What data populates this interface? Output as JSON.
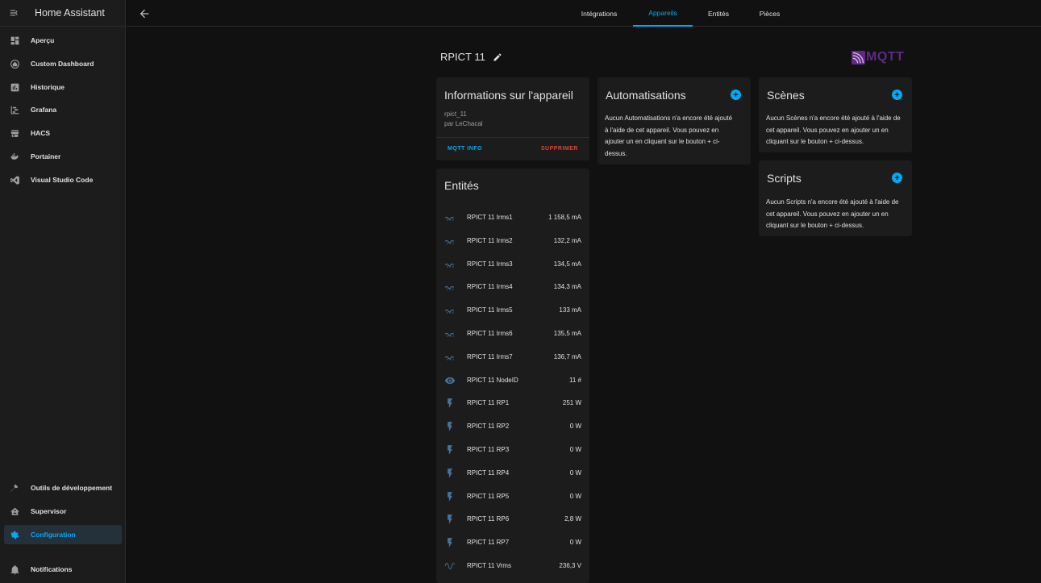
{
  "app": {
    "title": "Home Assistant"
  },
  "sidebar": {
    "items": [
      {
        "label": "Aperçu",
        "icon": "dashboard-icon"
      },
      {
        "label": "Custom Dashboard",
        "icon": "home-assistant-icon"
      },
      {
        "label": "Historique",
        "icon": "chart-icon"
      },
      {
        "label": "Grafana",
        "icon": "chart-timeline-icon"
      },
      {
        "label": "HACS",
        "icon": "store-icon"
      },
      {
        "label": "Portainer",
        "icon": "docker-icon"
      },
      {
        "label": "Visual Studio Code",
        "icon": "vscode-icon"
      }
    ],
    "bottom_items": [
      {
        "label": "Outils de développement",
        "icon": "hammer-icon"
      },
      {
        "label": "Supervisor",
        "icon": "supervisor-icon"
      },
      {
        "label": "Configuration",
        "icon": "gear-icon"
      }
    ],
    "notifications_label": "Notifications",
    "active_color": "#03a9f4"
  },
  "topbar": {
    "tabs": [
      {
        "label": "Intégrations"
      },
      {
        "label": "Appareils"
      },
      {
        "label": "Entités"
      },
      {
        "label": "Pièces"
      }
    ]
  },
  "device": {
    "name": "RPICT 11",
    "logo_text": "MQTT"
  },
  "info_card": {
    "title": "Informations sur l'appareil",
    "model": "rpict_11",
    "manufacturer": "par LeChacal",
    "mqtt_info": "MQTT INFO",
    "delete": "SUPPRIMER",
    "delete_color": "#db4437"
  },
  "entities_card": {
    "title": "Entités",
    "rows": [
      {
        "name": "RPICT 11 Irms1",
        "value": "1 158,5 mA",
        "icon": "current-ac-icon"
      },
      {
        "name": "RPICT 11 Irms2",
        "value": "132,2 mA",
        "icon": "current-ac-icon"
      },
      {
        "name": "RPICT 11 Irms3",
        "value": "134,5 mA",
        "icon": "current-ac-icon"
      },
      {
        "name": "RPICT 11 Irms4",
        "value": "134,3 mA",
        "icon": "current-ac-icon"
      },
      {
        "name": "RPICT 11 Irms5",
        "value": "133 mA",
        "icon": "current-ac-icon"
      },
      {
        "name": "RPICT 11 Irms6",
        "value": "135,5 mA",
        "icon": "current-ac-icon"
      },
      {
        "name": "RPICT 11 Irms7",
        "value": "136,7 mA",
        "icon": "current-ac-icon"
      },
      {
        "name": "RPICT 11 NodeID",
        "value": "11 #",
        "icon": "eye-icon"
      },
      {
        "name": "RPICT 11 RP1",
        "value": "251 W",
        "icon": "flash-icon"
      },
      {
        "name": "RPICT 11 RP2",
        "value": "0 W",
        "icon": "flash-icon"
      },
      {
        "name": "RPICT 11 RP3",
        "value": "0 W",
        "icon": "flash-icon"
      },
      {
        "name": "RPICT 11 RP4",
        "value": "0 W",
        "icon": "flash-icon"
      },
      {
        "name": "RPICT 11 RP5",
        "value": "0 W",
        "icon": "flash-icon"
      },
      {
        "name": "RPICT 11 RP6",
        "value": "2,8 W",
        "icon": "flash-icon"
      },
      {
        "name": "RPICT 11 RP7",
        "value": "0 W",
        "icon": "flash-icon"
      },
      {
        "name": "RPICT 11 Vrms",
        "value": "236,3 V",
        "icon": "sine-wave-icon"
      }
    ]
  },
  "automations_card": {
    "title": "Automatisations",
    "text_lines": [
      "Aucun Automatisations n'a encore été ajouté",
      "à l'aide de cet appareil. Vous pouvez en",
      "ajouter un en cliquant sur le bouton + ci-",
      "dessus."
    ]
  },
  "scenes_card": {
    "title": "Scènes",
    "text_lines": [
      "Aucun Scènes n'a encore été ajouté à l'aide de",
      "cet appareil. Vous pouvez en ajouter un en",
      "cliquant sur le bouton + ci-dessus."
    ]
  },
  "scripts_card": {
    "title": "Scripts",
    "text_lines": [
      "Aucun Scripts n'a encore été ajouté à l'aide de",
      "cet appareil. Vous pouvez en ajouter un en",
      "cliquant sur le bouton + ci-dessus."
    ]
  }
}
